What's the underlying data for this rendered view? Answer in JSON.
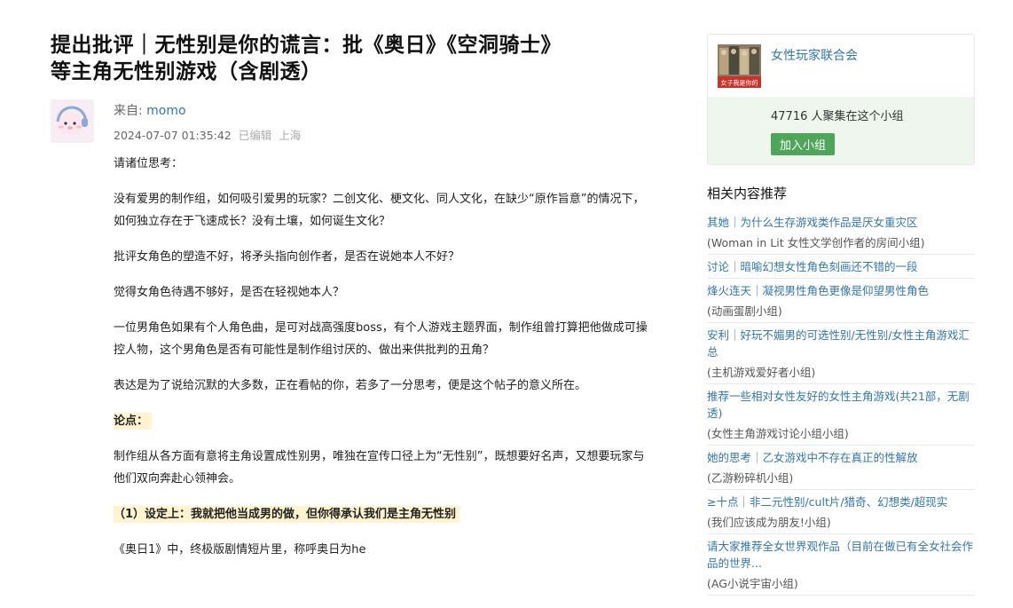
{
  "post": {
    "title_line1": "提出批评｜无性别是你的谎言：批《奥日》《空洞骑士》",
    "title_line2": "等主角无性别游戏（含剧透）",
    "from_label": "来自: ",
    "author": "momo",
    "datetime": "2024-07-07 01:35:42",
    "edited": "已编辑",
    "location": "上海",
    "paragraphs": [
      "请诸位思考：",
      "没有爱男的制作组，如何吸引爱男的玩家？二创文化、梗文化、同人文化，在缺少“原作旨意”的情况下，如何独立存在于飞速成长？没有土壤，如何诞生文化？",
      "批评女角色的塑造不好，将矛头指向创作者，是否在说她本人不好？",
      "觉得女角色待遇不够好，是否在轻视她本人？",
      "一位男角色如果有个人角色曲，是可对战高强度boss，有个人游戏主题界面，制作组曾打算把他做成可操控人物，这个男角色是否有可能性是制作组讨厌的、做出来供批判的丑角？",
      "表达是为了说给沉默的大多数，正在看帖的你，若多了一分思考，便是这个帖子的意义所在。"
    ],
    "argument_heading": "论点：",
    "argument_text": "制作组从各方面有意将主角设置成性别男，唯独在宣传口径上为“无性别”，既想要好名声，又想要玩家与他们双向奔赴心领神会。",
    "point1_heading": "（1）设定上：我就把他当成男的做，但你得承认我们是主角无性别",
    "last_line": "《奥日1》中，终极版剧情短片里，称呼奥日为he"
  },
  "sidebar": {
    "group_name": "女性玩家联合会",
    "members": "47716 人聚集在这个小组",
    "join_label": "加入小组",
    "logo_caption": "女子我是你的",
    "rec_title": "相关内容推荐",
    "items": [
      {
        "title": "其她｜为什么生存游戏类作品是厌女重灾区",
        "group": "(Woman in Lit 女性文学创作者的房间小组)"
      },
      {
        "title": "讨论｜暗喻幻想女性角色刻画还不错的一段",
        "group": ""
      },
      {
        "title": "烽火连天｜凝视男性角色更像是仰望男性角色",
        "group": "(动画蛋剧小组)"
      },
      {
        "title": "安利｜好玩不媚男的可选性别/无性别/女性主角游戏汇总",
        "group": "(主机游戏爱好者小组)"
      },
      {
        "title": "推荐一些相对女性友好的女性主角游戏(共21部，无剧透)",
        "group": "(女性主角游戏讨论小组小组)"
      },
      {
        "title": "她的思考｜乙女游戏中不存在真正的性解放",
        "group": "(乙游粉碎机小组)"
      },
      {
        "title": "≥十点｜非二元性别/cult片/猎奇、幻想类/超现实",
        "group": "(我们应该成为朋友!小组)"
      },
      {
        "title": "请大家推荐全女世界观作品（目前在做已有全女社会作品的世界...",
        "group": "(AG小说宇宙小组)"
      }
    ]
  },
  "colors": {
    "link": "#3377aa",
    "join_button": "#4fa55a",
    "group_bg": "#eef6ed",
    "highlight": "#fff4cf"
  }
}
